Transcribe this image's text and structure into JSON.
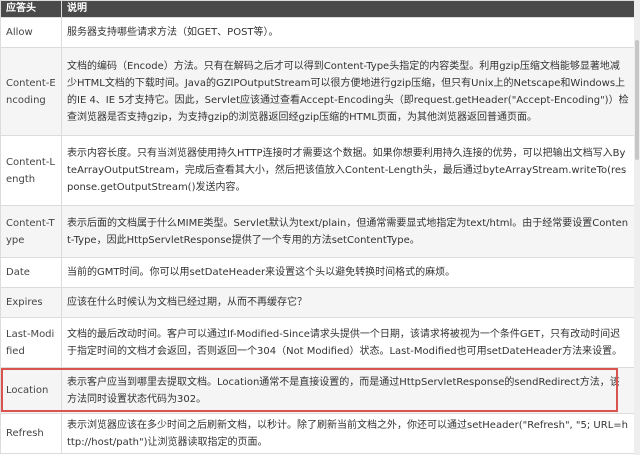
{
  "table": {
    "headers": [
      "应答头",
      "说明"
    ],
    "rows": [
      {
        "name": "Allow",
        "desc": "服务器支持哪些请求方法（如GET、POST等）。"
      },
      {
        "name": "Content-Encoding",
        "desc": "文档的编码（Encode）方法。只有在解码之后才可以得到Content-Type头指定的内容类型。利用gzip压缩文档能够显著地减少HTML文档的下载时间。Java的GZIPOutputStream可以很方便地进行gzip压缩，但只有Unix上的Netscape和Windows上的IE 4、IE 5才支持它。因此，Servlet应该通过查看Accept-Encoding头（即request.getHeader(\"Accept-Encoding\")）检查浏览器是否支持gzip，为支持gzip的浏览器返回经gzip压缩的HTML页面，为其他浏览器返回普通页面。"
      },
      {
        "name": "Content-Length",
        "desc": "表示内容长度。只有当浏览器使用持久HTTP连接时才需要这个数据。如果你想要利用持久连接的优势，可以把输出文档写入ByteArrayOutputStream，完成后查看其大小，然后把该值放入Content-Length头，最后通过byteArrayStream.writeTo(response.getOutputStream()发送内容。"
      },
      {
        "name": "Content-Type",
        "desc": "表示后面的文档属于什么MIME类型。Servlet默认为text/plain，但通常需要显式地指定为text/html。由于经常要设置Content-Type，因此HttpServletResponse提供了一个专用的方法setContentType。"
      },
      {
        "name": "Date",
        "desc": "当前的GMT时间。你可以用setDateHeader来设置这个头以避免转换时间格式的麻烦。"
      },
      {
        "name": "Expires",
        "desc": "应该在什么时候认为文档已经过期，从而不再缓存它？"
      },
      {
        "name": "Last-Modified",
        "desc": "文档的最后改动时间。客户可以通过If-Modified-Since请求头提供一个日期，该请求将被视为一个条件GET，只有改动时间迟于指定时间的文档才会返回，否则返回一个304（Not Modified）状态。Last-Modified也可用setDateHeader方法来设置。"
      },
      {
        "name": "Location",
        "desc": "表示客户应当到哪里去提取文档。Location通常不是直接设置的，而是通过HttpServletResponse的sendRedirect方法，该方法同时设置状态代码为302。"
      },
      {
        "name": "Refresh",
        "desc": "表示浏览器应该在多少时间之后刷新文档，以秒计。除了刷新当前文档之外，你还可以通过setHeader(\"Refresh\", \"5; URL=http://host/path\")让浏览器读取指定的页面。"
      }
    ]
  },
  "colors": {
    "header_bg": "#4a4a4a",
    "highlight": "#d9534f"
  }
}
